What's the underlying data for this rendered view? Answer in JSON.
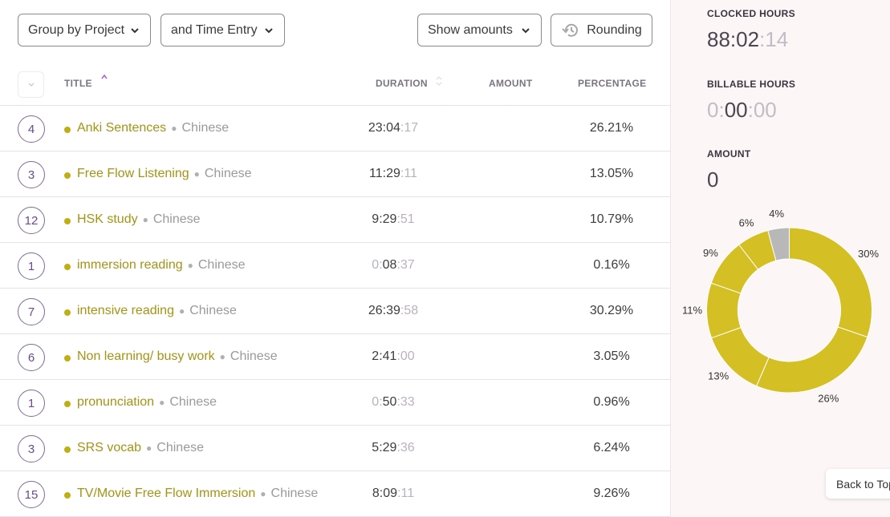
{
  "toolbar": {
    "group_by": "Group by Project",
    "time_entry": "and Time Entry",
    "show_amounts": "Show amounts",
    "rounding": "Rounding"
  },
  "table": {
    "headers": {
      "title": "TITLE",
      "duration": "DURATION",
      "amount": "AMOUNT",
      "percentage": "PERCENTAGE"
    },
    "rows": [
      {
        "count": "4",
        "project": "Anki Sentences",
        "client": "Chinese",
        "dur_main": "23:04",
        "dur_sec": ":17",
        "dur_lead": "",
        "pct": "26.21%"
      },
      {
        "count": "3",
        "project": "Free Flow Listening",
        "client": "Chinese",
        "dur_main": "11:29",
        "dur_sec": ":11",
        "dur_lead": "",
        "pct": "13.05%"
      },
      {
        "count": "12",
        "project": "HSK study",
        "client": "Chinese",
        "dur_main": "9:29",
        "dur_sec": ":51",
        "dur_lead": "",
        "pct": "10.79%"
      },
      {
        "count": "1",
        "project": "immersion reading",
        "client": "Chinese",
        "dur_lead": "0:",
        "dur_main": "08",
        "dur_sec": ":37",
        "pct": "0.16%"
      },
      {
        "count": "7",
        "project": "intensive reading",
        "client": "Chinese",
        "dur_main": "26:39",
        "dur_sec": ":58",
        "dur_lead": "",
        "pct": "30.29%"
      },
      {
        "count": "6",
        "project": "Non learning/ busy work",
        "client": "Chinese",
        "dur_main": "2:41",
        "dur_sec": ":00",
        "dur_lead": "",
        "pct": "3.05%"
      },
      {
        "count": "1",
        "project": "pronunciation",
        "client": "Chinese",
        "dur_lead": "0:",
        "dur_main": "50",
        "dur_sec": ":33",
        "pct": "0.96%"
      },
      {
        "count": "3",
        "project": "SRS vocab",
        "client": "Chinese",
        "dur_main": "5:29",
        "dur_sec": ":36",
        "dur_lead": "",
        "pct": "6.24%"
      },
      {
        "count": "15",
        "project": "TV/Movie Free Flow Immersion",
        "client": "Chinese",
        "dur_main": "8:09",
        "dur_sec": ":11",
        "dur_lead": "",
        "pct": "9.26%"
      }
    ]
  },
  "summary": {
    "clocked_label": "CLOCKED HOURS",
    "clocked_main": "88:02",
    "clocked_sec": ":14",
    "billable_label": "BILLABLE HOURS",
    "billable_lead": "0:",
    "billable_main": "00",
    "billable_sec": ":00",
    "amount_label": "AMOUNT",
    "amount_value": "0"
  },
  "donut": {
    "segments": [
      {
        "label": "30%",
        "value": 30.29,
        "color": "#d4bf25"
      },
      {
        "label": "26%",
        "value": 26.21,
        "color": "#d4bf25"
      },
      {
        "label": "13%",
        "value": 13.05,
        "color": "#d4bf25"
      },
      {
        "label": "11%",
        "value": 10.79,
        "color": "#d4bf25"
      },
      {
        "label": "9%",
        "value": 9.26,
        "color": "#d4bf25"
      },
      {
        "label": "6%",
        "value": 6.24,
        "color": "#d4bf25"
      },
      {
        "label": "4%",
        "value": 4.17,
        "color": "#b8b8b8"
      }
    ]
  },
  "back_to_top": "Back to Top",
  "colors": {
    "project": "#a39413",
    "dot": "#bfae14",
    "accent": "#6b4a8f"
  }
}
